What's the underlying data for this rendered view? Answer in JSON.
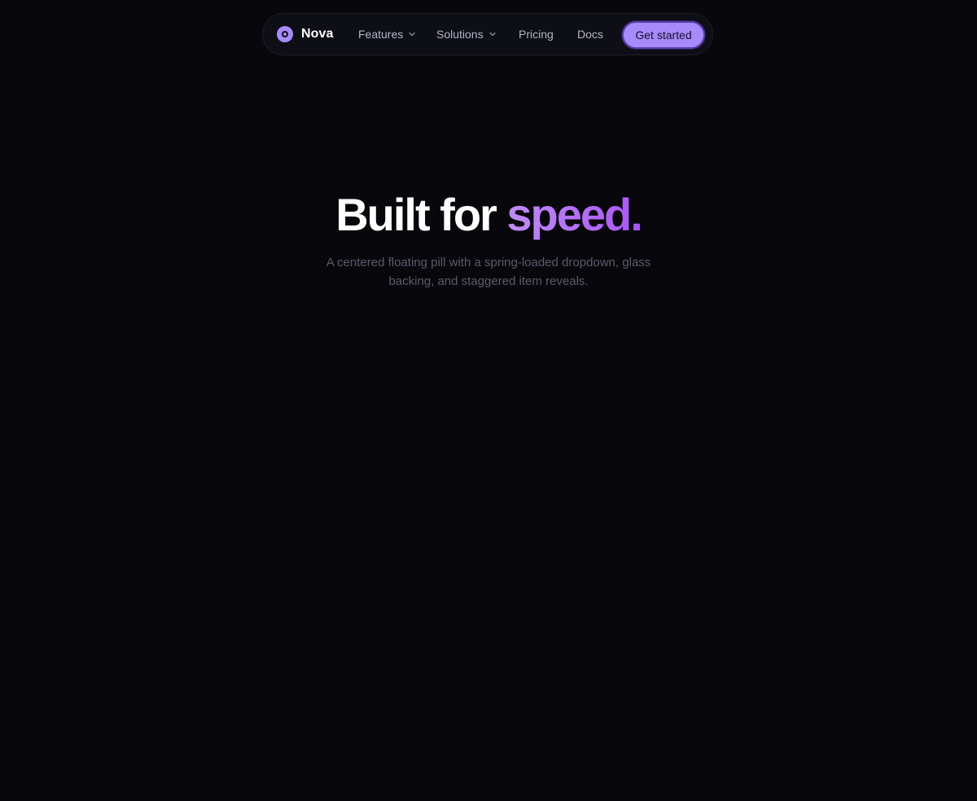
{
  "nav": {
    "brand": "Nova",
    "items": [
      {
        "label": "Features",
        "has_dropdown": true
      },
      {
        "label": "Solutions",
        "has_dropdown": true
      },
      {
        "label": "Pricing",
        "has_dropdown": false
      },
      {
        "label": "Docs",
        "has_dropdown": false
      }
    ],
    "cta_label": "Get started"
  },
  "hero": {
    "title_main": "Built for ",
    "title_accent": "speed.",
    "subtitle": "A centered floating pill with a spring-loaded dropdown, glass backing, and staggered item reveals."
  },
  "icons": {
    "logo": "nova-logo-icon",
    "dropdown": "chevron-down-icon"
  },
  "colors": {
    "background": "#07070c",
    "pill": "#0e0e17",
    "accent": "#a78bfa",
    "accent_gradient_end": "#a855f7",
    "nav_text": "#b5b5c4",
    "subtitle_text": "#5b5b6b"
  }
}
